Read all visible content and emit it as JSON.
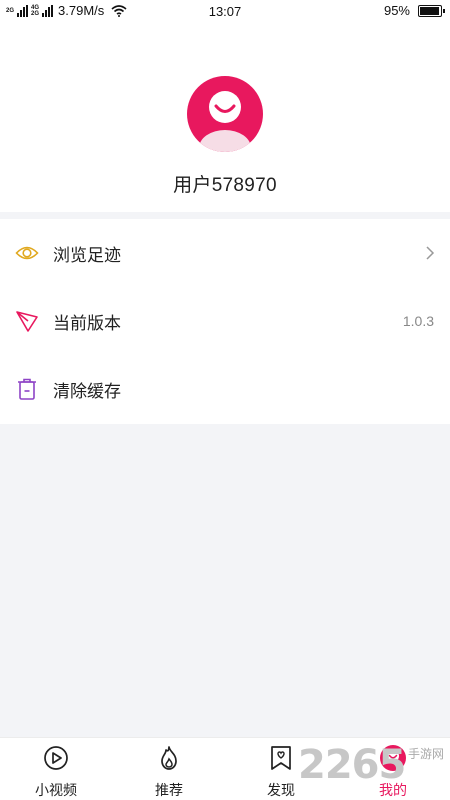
{
  "status_bar": {
    "network_1": "2G",
    "network_2": "4G",
    "network_3": "2G",
    "speed": "3.79M/s",
    "time": "13:07",
    "battery_text": "95%",
    "battery_level": 0.95
  },
  "profile": {
    "username": "用户578970",
    "avatar_color": "#e8185e"
  },
  "menu": {
    "items": [
      {
        "label": "浏览足迹",
        "icon": "eye-icon",
        "trail": "",
        "icon_color": "#e0a81e"
      },
      {
        "label": "当前版本",
        "icon": "paper-plane-icon",
        "trail": "1.0.3",
        "icon_color": "#e8185e"
      },
      {
        "label": "清除缓存",
        "icon": "trash-icon",
        "trail": "",
        "icon_color": "#8e44c6"
      }
    ]
  },
  "tabbar": {
    "tabs": [
      {
        "label": "小视频",
        "icon": "play-circle-icon",
        "active": false
      },
      {
        "label": "推荐",
        "icon": "flame-icon",
        "active": false
      },
      {
        "label": "发现",
        "icon": "bookmark-heart-icon",
        "active": false
      },
      {
        "label": "我的",
        "icon": "smile-avatar-icon",
        "active": true
      }
    ],
    "active_color": "#e8185e"
  },
  "watermark": {
    "number": "2265",
    "text": "手游网"
  }
}
